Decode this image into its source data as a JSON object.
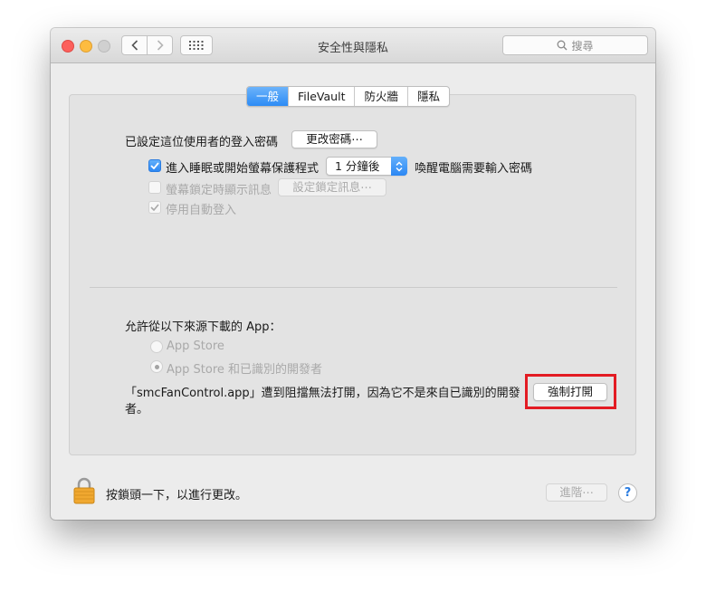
{
  "window": {
    "title": "安全性與隱私"
  },
  "search": {
    "placeholder": "搜尋"
  },
  "tabs": [
    {
      "label": "一般",
      "active": true
    },
    {
      "label": "FileVault",
      "active": false
    },
    {
      "label": "防火牆",
      "active": false
    },
    {
      "label": "隱私",
      "active": false
    }
  ],
  "general": {
    "password_label": "已設定這位使用者的登入密碼",
    "change_password_button": "更改密碼⋯",
    "require_password": {
      "checked": true,
      "label_before": "進入睡眠或開始螢幕保護程式",
      "delay_value": "1 分鐘後",
      "label_after": "喚醒電腦需要輸入密碼"
    },
    "show_message": {
      "checked": false,
      "label": "螢幕鎖定時顯示訊息",
      "button": "設定鎖定訊息⋯"
    },
    "disable_auto_login": {
      "checked": true,
      "label": "停用自動登入"
    }
  },
  "downloads": {
    "title": "允許從以下來源下載的 App：",
    "options": [
      {
        "label": "App Store",
        "selected": false
      },
      {
        "label": "App Store 和已識別的開發者",
        "selected": true
      }
    ],
    "blocked_message": "「smcFanControl.app」遭到阻擋無法打開，因為它不是來自已識別的開發者。",
    "open_anyway_button": "強制打開"
  },
  "footer": {
    "lock_text": "按鎖頭一下，以進行更改。",
    "advanced_button": "進階⋯",
    "help_label": "?"
  },
  "colors": {
    "accent": "#2c8bf5",
    "highlight_box": "#e31b23",
    "lock_gold": "#f0a830"
  }
}
